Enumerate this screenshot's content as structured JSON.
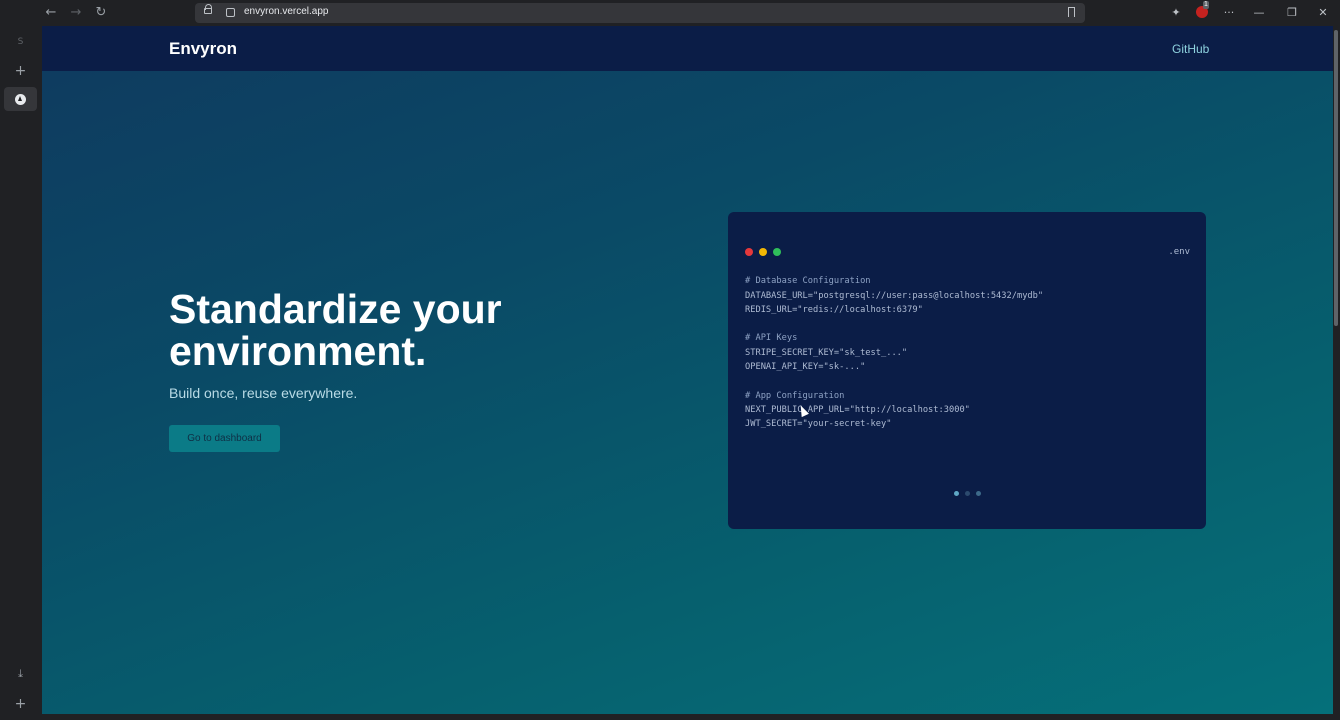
{
  "browser": {
    "url": "envyron.vercel.app",
    "extension_badge": "1",
    "icons": {
      "back": "arrow-left-icon",
      "forward": "arrow-right-icon",
      "reload": "reload-icon",
      "lock": "lock-icon",
      "site_settings": "site-settings-icon",
      "bookmark": "bookmark-icon",
      "extensions": "puzzle-icon",
      "menu": "more-icon",
      "minimize": "minimize-icon",
      "restore": "restore-icon",
      "close": "close-icon"
    }
  },
  "sidepanel": {
    "top_label": "S",
    "icons": [
      "plus-icon",
      "vercel-icon",
      "download-icon",
      "plus-icon"
    ]
  },
  "site": {
    "brand": "Envyron",
    "github_link": "GitHub",
    "hero_title": "Standardize your environment.",
    "hero_subtitle": "Build once, reuse everywhere.",
    "cta_label": "Go to dashboard"
  },
  "code_window": {
    "filename": ".env",
    "lines": [
      "# Database Configuration",
      "DATABASE_URL=\"postgresql://user:pass@localhost:5432/mydb\"",
      "REDIS_URL=\"redis://localhost:6379\"",
      "# API Keys",
      "STRIPE_SECRET_KEY=\"sk_test_...\"",
      "OPENAI_API_KEY=\"sk-...\"",
      "# App Configuration",
      "NEXT_PUBLIC_APP_URL=\"http://localhost:3000\"",
      "JWT_SECRET=\"your-secret-key\""
    ],
    "active_slide": 1,
    "slide_count": 3
  },
  "colors": {
    "header_bg": "#0b1d47",
    "cta_bg": "#0b7b87",
    "link": "#8fd3df"
  }
}
